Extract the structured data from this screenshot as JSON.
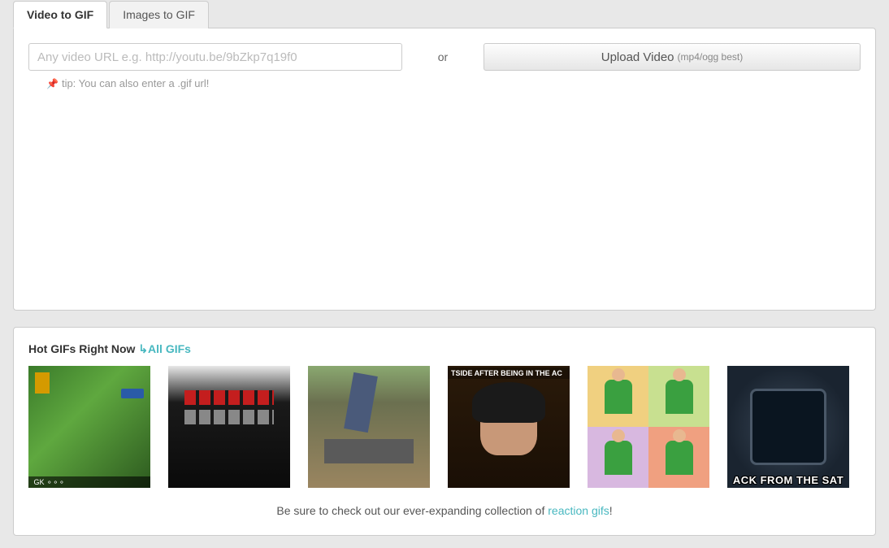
{
  "tabs": {
    "video": "Video to GIF",
    "images": "Images to GIF"
  },
  "input": {
    "placeholder": "Any video URL e.g. http://youtu.be/9bZkp7q19f0",
    "or": "or",
    "upload_label": "Upload Video",
    "upload_hint": "(mp4/ogg best)",
    "tip": "tip: You can also enter a .gif url!"
  },
  "hot": {
    "title": "Hot GIFs Right Now",
    "all_link": "↳All GIFs",
    "thumb4_caption": "TSIDE AFTER BEING IN THE AC",
    "thumb6_caption": "ACK FROM THE SAT",
    "footer_pre": "Be sure to check out our ever-expanding collection of ",
    "footer_link": "reaction gifs",
    "footer_post": "!"
  }
}
